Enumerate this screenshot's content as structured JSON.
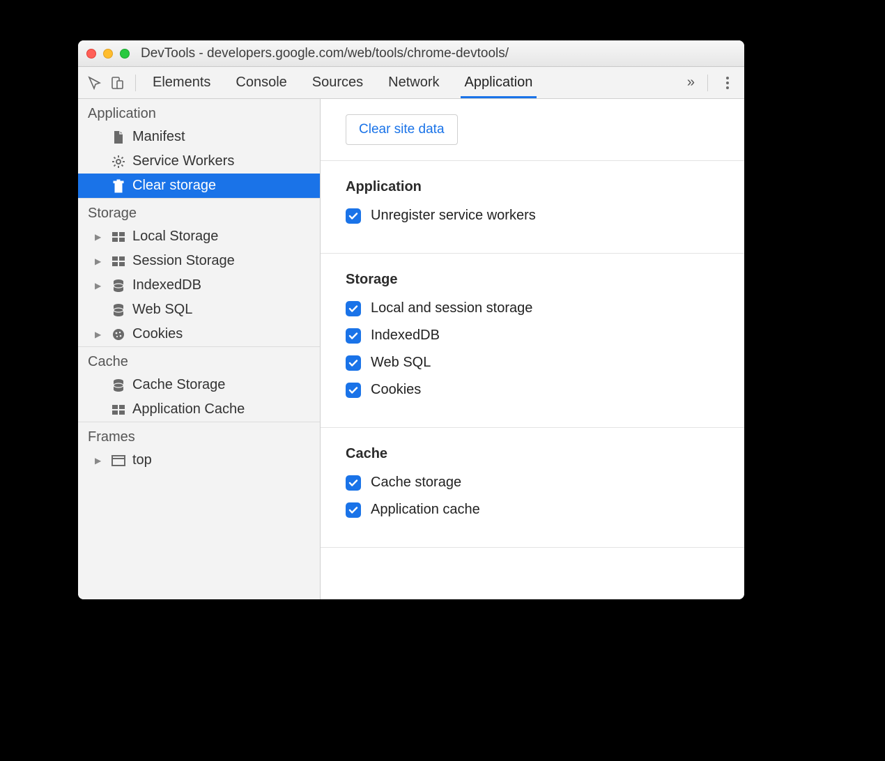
{
  "window": {
    "title": "DevTools - developers.google.com/web/tools/chrome-devtools/"
  },
  "toolbar": {
    "tabs": [
      "Elements",
      "Console",
      "Sources",
      "Network",
      "Application"
    ],
    "active_tab": "Application"
  },
  "sidebar": {
    "groups": [
      {
        "title": "Application",
        "items": [
          {
            "label": "Manifest",
            "icon": "file",
            "expandable": false,
            "selected": false
          },
          {
            "label": "Service Workers",
            "icon": "gear",
            "expandable": false,
            "selected": false
          },
          {
            "label": "Clear storage",
            "icon": "trash",
            "expandable": false,
            "selected": true
          }
        ]
      },
      {
        "title": "Storage",
        "items": [
          {
            "label": "Local Storage",
            "icon": "grid",
            "expandable": true,
            "selected": false
          },
          {
            "label": "Session Storage",
            "icon": "grid",
            "expandable": true,
            "selected": false
          },
          {
            "label": "IndexedDB",
            "icon": "db",
            "expandable": true,
            "selected": false
          },
          {
            "label": "Web SQL",
            "icon": "db",
            "expandable": false,
            "selected": false
          },
          {
            "label": "Cookies",
            "icon": "cookie",
            "expandable": true,
            "selected": false
          }
        ]
      },
      {
        "title": "Cache",
        "items": [
          {
            "label": "Cache Storage",
            "icon": "db",
            "expandable": false,
            "selected": false
          },
          {
            "label": "Application Cache",
            "icon": "grid",
            "expandable": false,
            "selected": false
          }
        ]
      },
      {
        "title": "Frames",
        "items": [
          {
            "label": "top",
            "icon": "frame",
            "expandable": true,
            "selected": false
          }
        ]
      }
    ]
  },
  "main": {
    "clear_button": "Clear site data",
    "sections": [
      {
        "title": "Application",
        "checks": [
          {
            "label": "Unregister service workers",
            "checked": true
          }
        ]
      },
      {
        "title": "Storage",
        "checks": [
          {
            "label": "Local and session storage",
            "checked": true
          },
          {
            "label": "IndexedDB",
            "checked": true
          },
          {
            "label": "Web SQL",
            "checked": true
          },
          {
            "label": "Cookies",
            "checked": true
          }
        ]
      },
      {
        "title": "Cache",
        "checks": [
          {
            "label": "Cache storage",
            "checked": true
          },
          {
            "label": "Application cache",
            "checked": true
          }
        ]
      }
    ]
  }
}
